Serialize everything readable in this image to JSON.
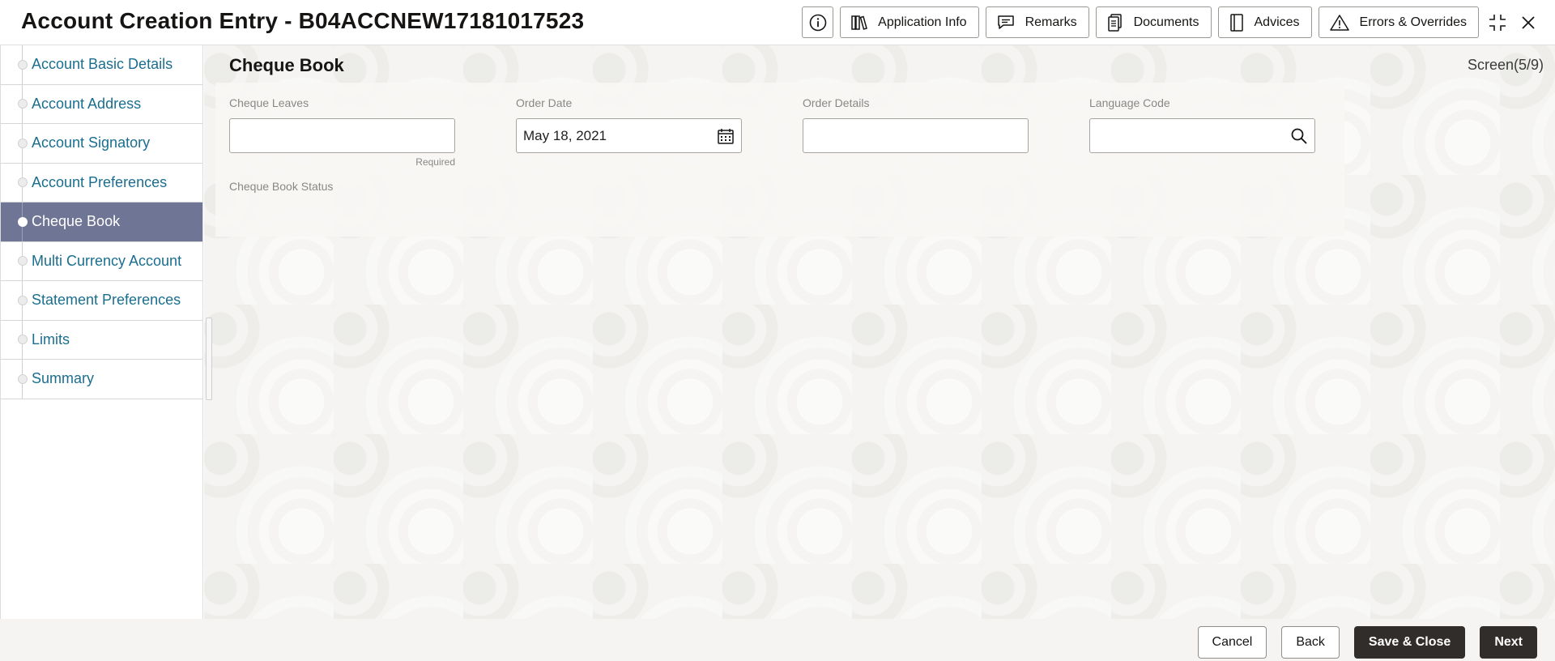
{
  "header": {
    "title": "Account Creation Entry - B04ACCNEW17181017523",
    "toolbar": [
      {
        "id": "info",
        "label": "",
        "icon": "info-icon"
      },
      {
        "id": "application-info",
        "label": "Application Info",
        "icon": "books-icon"
      },
      {
        "id": "remarks",
        "label": "Remarks",
        "icon": "speech-bubble-icon"
      },
      {
        "id": "documents",
        "label": "Documents",
        "icon": "documents-icon"
      },
      {
        "id": "advices",
        "label": "Advices",
        "icon": "notebook-icon"
      },
      {
        "id": "errors-overrides",
        "label": "Errors & Overrides",
        "icon": "warning-icon"
      }
    ]
  },
  "sidebar": {
    "items": [
      {
        "label": "Account Basic Details",
        "active": false
      },
      {
        "label": "Account Address",
        "active": false
      },
      {
        "label": "Account Signatory",
        "active": false
      },
      {
        "label": "Account Preferences",
        "active": false
      },
      {
        "label": "Cheque Book",
        "active": true
      },
      {
        "label": "Multi Currency Account",
        "active": false
      },
      {
        "label": "Statement Preferences",
        "active": false
      },
      {
        "label": "Limits",
        "active": false
      },
      {
        "label": "Summary",
        "active": false
      }
    ]
  },
  "main": {
    "section_title": "Cheque Book",
    "screen_indicator": "Screen(5/9)",
    "fields": {
      "cheque_leaves": {
        "label": "Cheque Leaves",
        "value": "",
        "hint": "Required"
      },
      "order_date": {
        "label": "Order Date",
        "value": "May 18, 2021"
      },
      "order_details": {
        "label": "Order Details",
        "value": ""
      },
      "language_code": {
        "label": "Language Code",
        "value": ""
      },
      "cheque_book_status": {
        "label": "Cheque Book Status"
      }
    }
  },
  "footer": {
    "cancel": "Cancel",
    "back": "Back",
    "save_close": "Save & Close",
    "next": "Next"
  },
  "colors": {
    "active_nav_bg": "#6f7594",
    "nav_text": "#1b6e8f",
    "primary_button": "#312d2a",
    "content_bg": "#f5f4f2"
  }
}
